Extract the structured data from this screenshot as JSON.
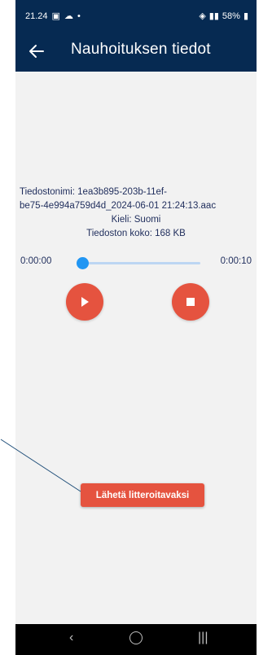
{
  "status_bar": {
    "time": "21.24",
    "battery": "58%",
    "signal_text": "⦿◀ ⌁ •│"
  },
  "app_bar": {
    "title": "Nauhoituksen tiedot",
    "back_icon": "arrow-left-icon"
  },
  "file_info": {
    "filename_line1": "Tiedostonimi: 1ea3b895-203b-11ef-",
    "filename_line2": "be75-4e994a759d4d_2024-06-01 21:24:13.aac",
    "language": "Kieli:  Suomi",
    "size": "Tiedoston koko: 168 KB"
  },
  "player": {
    "current_time": "0:00:00",
    "total_time": "0:00:10",
    "progress": 0.0,
    "play_icon": "play-icon",
    "stop_icon": "stop-icon"
  },
  "actions": {
    "send_label": "Lähetä litteroitavaksi"
  },
  "nav_bar": {
    "back": "‹",
    "home": "",
    "recent": "|||"
  },
  "colors": {
    "primary": "#062a52",
    "accent": "#e5533f",
    "slider": "#2196f3",
    "background": "#f2f2f2"
  }
}
